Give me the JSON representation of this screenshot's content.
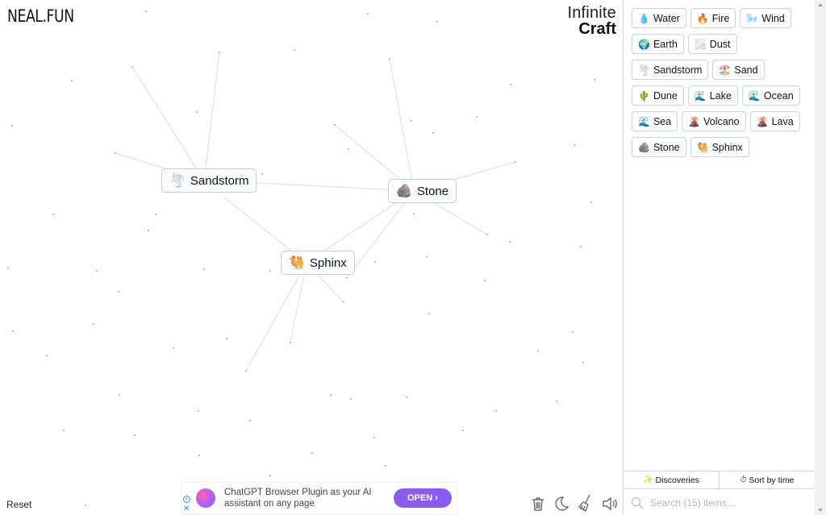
{
  "branding": {
    "site": "NEAL.FUN",
    "app_line1": "Infinite",
    "app_line2": "Craft"
  },
  "canvas": {
    "nodes": [
      {
        "id": "sandstorm",
        "icon": "tornado-icon",
        "emoji": "🌪️",
        "label": "Sandstorm"
      },
      {
        "id": "stone",
        "icon": "rock-icon",
        "emoji": "🪨",
        "label": "Stone"
      },
      {
        "id": "sphinx",
        "icon": "camel-icon",
        "emoji": "🐫",
        "label": "Sphinx"
      }
    ],
    "reset_label": "Reset"
  },
  "ad": {
    "text": "ChatGPT Browser Plugin as your AI assistant on any page",
    "button_label": "OPEN ›",
    "info_glyph": "i",
    "close_glyph": "✕"
  },
  "toolbar": {
    "tools": [
      {
        "name": "trash-icon",
        "label": "Clear"
      },
      {
        "name": "moon-icon",
        "label": "Dark mode"
      },
      {
        "name": "broom-icon",
        "label": "Clean up"
      },
      {
        "name": "speaker-icon",
        "label": "Sound"
      }
    ]
  },
  "sidebar": {
    "items": [
      {
        "emoji": "💧",
        "icon": "droplet-icon",
        "label": "Water"
      },
      {
        "emoji": "🔥",
        "icon": "fire-icon",
        "label": "Fire"
      },
      {
        "emoji": "🌬️",
        "icon": "wind-icon",
        "label": "Wind"
      },
      {
        "emoji": "🌍",
        "icon": "globe-icon",
        "label": "Earth"
      },
      {
        "emoji": "🌫️",
        "icon": "dust-icon",
        "label": "Dust"
      },
      {
        "emoji": "🌪️",
        "icon": "tornado-icon",
        "label": "Sandstorm"
      },
      {
        "emoji": "🏖️",
        "icon": "beach-icon",
        "label": "Sand"
      },
      {
        "emoji": "🌵",
        "icon": "cactus-icon",
        "label": "Dune"
      },
      {
        "emoji": "🌊",
        "icon": "wave-icon",
        "label": "Lake"
      },
      {
        "emoji": "🌊",
        "icon": "wave-icon",
        "label": "Ocean"
      },
      {
        "emoji": "🌊",
        "icon": "wave-icon",
        "label": "Sea"
      },
      {
        "emoji": "🌋",
        "icon": "volcano-icon",
        "label": "Volcano"
      },
      {
        "emoji": "🌋",
        "icon": "volcano-icon",
        "label": "Lava"
      },
      {
        "emoji": "🪨",
        "icon": "rock-icon",
        "label": "Stone"
      },
      {
        "emoji": "🐫",
        "icon": "camel-icon",
        "label": "Sphinx"
      }
    ],
    "tabs": {
      "discoveries": "Discoveries",
      "sort": "Sort by time"
    },
    "search": {
      "value": "",
      "placeholder": "Search (15) items..."
    }
  }
}
